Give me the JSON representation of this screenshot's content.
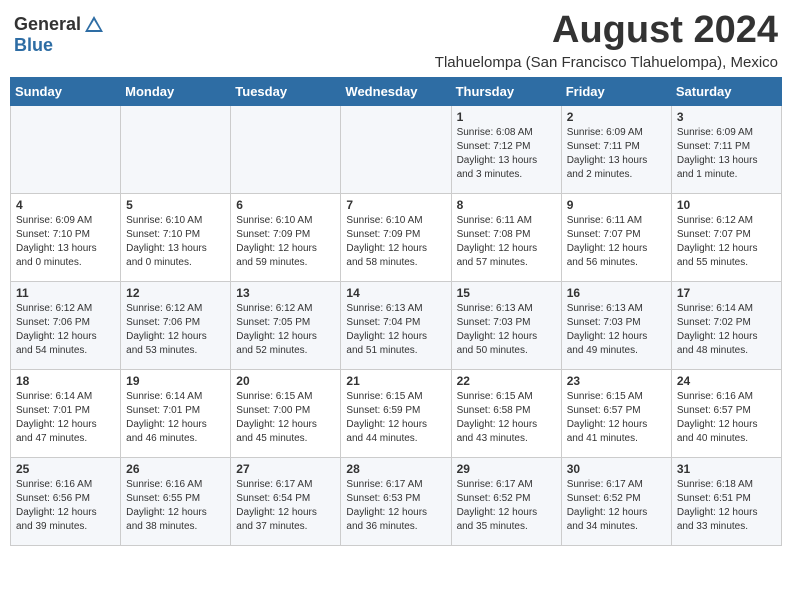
{
  "header": {
    "logo_general": "General",
    "logo_blue": "Blue",
    "month_title": "August 2024",
    "location": "Tlahuelompa (San Francisco Tlahuelompa), Mexico"
  },
  "weekdays": [
    "Sunday",
    "Monday",
    "Tuesday",
    "Wednesday",
    "Thursday",
    "Friday",
    "Saturday"
  ],
  "weeks": [
    {
      "days": [
        {
          "num": "",
          "info": ""
        },
        {
          "num": "",
          "info": ""
        },
        {
          "num": "",
          "info": ""
        },
        {
          "num": "",
          "info": ""
        },
        {
          "num": "1",
          "sunrise": "6:08 AM",
          "sunset": "7:12 PM",
          "daylight": "13 hours and 3 minutes."
        },
        {
          "num": "2",
          "sunrise": "6:09 AM",
          "sunset": "7:11 PM",
          "daylight": "13 hours and 2 minutes."
        },
        {
          "num": "3",
          "sunrise": "6:09 AM",
          "sunset": "7:11 PM",
          "daylight": "13 hours and 1 minute."
        }
      ]
    },
    {
      "days": [
        {
          "num": "4",
          "sunrise": "6:09 AM",
          "sunset": "7:10 PM",
          "daylight": "13 hours and 0 minutes."
        },
        {
          "num": "5",
          "sunrise": "6:10 AM",
          "sunset": "7:10 PM",
          "daylight": "13 hours and 0 minutes."
        },
        {
          "num": "6",
          "sunrise": "6:10 AM",
          "sunset": "7:09 PM",
          "daylight": "12 hours and 59 minutes."
        },
        {
          "num": "7",
          "sunrise": "6:10 AM",
          "sunset": "7:09 PM",
          "daylight": "12 hours and 58 minutes."
        },
        {
          "num": "8",
          "sunrise": "6:11 AM",
          "sunset": "7:08 PM",
          "daylight": "12 hours and 57 minutes."
        },
        {
          "num": "9",
          "sunrise": "6:11 AM",
          "sunset": "7:07 PM",
          "daylight": "12 hours and 56 minutes."
        },
        {
          "num": "10",
          "sunrise": "6:12 AM",
          "sunset": "7:07 PM",
          "daylight": "12 hours and 55 minutes."
        }
      ]
    },
    {
      "days": [
        {
          "num": "11",
          "sunrise": "6:12 AM",
          "sunset": "7:06 PM",
          "daylight": "12 hours and 54 minutes."
        },
        {
          "num": "12",
          "sunrise": "6:12 AM",
          "sunset": "7:06 PM",
          "daylight": "12 hours and 53 minutes."
        },
        {
          "num": "13",
          "sunrise": "6:12 AM",
          "sunset": "7:05 PM",
          "daylight": "12 hours and 52 minutes."
        },
        {
          "num": "14",
          "sunrise": "6:13 AM",
          "sunset": "7:04 PM",
          "daylight": "12 hours and 51 minutes."
        },
        {
          "num": "15",
          "sunrise": "6:13 AM",
          "sunset": "7:03 PM",
          "daylight": "12 hours and 50 minutes."
        },
        {
          "num": "16",
          "sunrise": "6:13 AM",
          "sunset": "7:03 PM",
          "daylight": "12 hours and 49 minutes."
        },
        {
          "num": "17",
          "sunrise": "6:14 AM",
          "sunset": "7:02 PM",
          "daylight": "12 hours and 48 minutes."
        }
      ]
    },
    {
      "days": [
        {
          "num": "18",
          "sunrise": "6:14 AM",
          "sunset": "7:01 PM",
          "daylight": "12 hours and 47 minutes."
        },
        {
          "num": "19",
          "sunrise": "6:14 AM",
          "sunset": "7:01 PM",
          "daylight": "12 hours and 46 minutes."
        },
        {
          "num": "20",
          "sunrise": "6:15 AM",
          "sunset": "7:00 PM",
          "daylight": "12 hours and 45 minutes."
        },
        {
          "num": "21",
          "sunrise": "6:15 AM",
          "sunset": "6:59 PM",
          "daylight": "12 hours and 44 minutes."
        },
        {
          "num": "22",
          "sunrise": "6:15 AM",
          "sunset": "6:58 PM",
          "daylight": "12 hours and 43 minutes."
        },
        {
          "num": "23",
          "sunrise": "6:15 AM",
          "sunset": "6:57 PM",
          "daylight": "12 hours and 41 minutes."
        },
        {
          "num": "24",
          "sunrise": "6:16 AM",
          "sunset": "6:57 PM",
          "daylight": "12 hours and 40 minutes."
        }
      ]
    },
    {
      "days": [
        {
          "num": "25",
          "sunrise": "6:16 AM",
          "sunset": "6:56 PM",
          "daylight": "12 hours and 39 minutes."
        },
        {
          "num": "26",
          "sunrise": "6:16 AM",
          "sunset": "6:55 PM",
          "daylight": "12 hours and 38 minutes."
        },
        {
          "num": "27",
          "sunrise": "6:17 AM",
          "sunset": "6:54 PM",
          "daylight": "12 hours and 37 minutes."
        },
        {
          "num": "28",
          "sunrise": "6:17 AM",
          "sunset": "6:53 PM",
          "daylight": "12 hours and 36 minutes."
        },
        {
          "num": "29",
          "sunrise": "6:17 AM",
          "sunset": "6:52 PM",
          "daylight": "12 hours and 35 minutes."
        },
        {
          "num": "30",
          "sunrise": "6:17 AM",
          "sunset": "6:52 PM",
          "daylight": "12 hours and 34 minutes."
        },
        {
          "num": "31",
          "sunrise": "6:18 AM",
          "sunset": "6:51 PM",
          "daylight": "12 hours and 33 minutes."
        }
      ]
    }
  ],
  "labels": {
    "sunrise": "Sunrise:",
    "sunset": "Sunset:",
    "daylight": "Daylight:"
  }
}
